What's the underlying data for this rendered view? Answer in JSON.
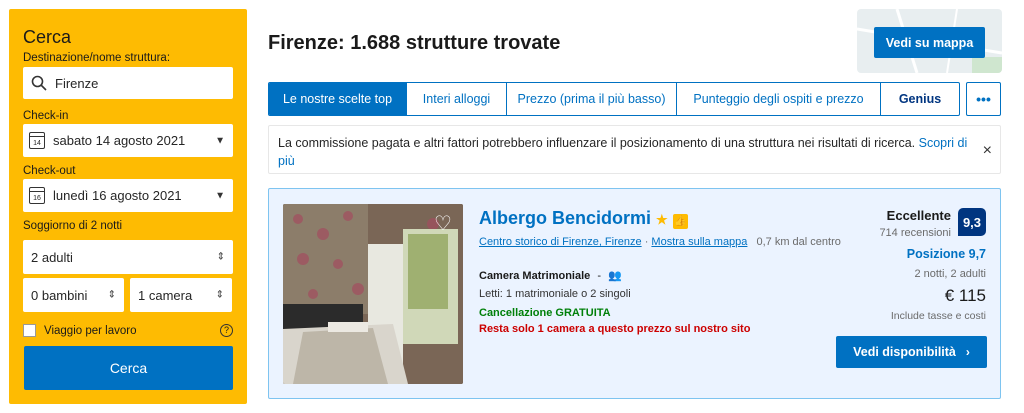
{
  "search": {
    "title": "Cerca",
    "destination_label": "Destinazione/nome struttura:",
    "destination_value": "Firenze",
    "checkin_label": "Check-in",
    "checkin_value": "sabato 14 agosto 2021",
    "checkin_day": "14",
    "checkout_label": "Check-out",
    "checkout_value": "lunedì 16 agosto 2021",
    "checkout_day": "16",
    "stay_label": "Soggiorno di 2 notti",
    "adults": "2 adulti",
    "children": "0 bambini",
    "rooms": "1 camera",
    "business_label": "Viaggio per lavoro",
    "help": "?",
    "submit": "Cerca"
  },
  "results": {
    "heading": "Firenze: 1.688 strutture trovate",
    "map_button": "Vedi su mappa"
  },
  "sort_tabs": [
    {
      "label": "Le nostre scelte top"
    },
    {
      "label": "Interi alloggi"
    },
    {
      "label": "Prezzo (prima il più basso)"
    },
    {
      "label": "Punteggio degli ospiti e prezzo"
    },
    {
      "label": "Genius"
    }
  ],
  "more_label": "•••",
  "notice": {
    "text": "La commissione pagata e altri fattori potrebbero influenzare il posizionamento di una struttura nei risultati di ricerca.",
    "link": "Scopri di più",
    "close": "×"
  },
  "property": {
    "name": "Albergo Bencidormi",
    "area": "Centro storico di Firenze, Firenze",
    "map_link": "Mostra sulla mappa",
    "distance": "0,7 km dal centro",
    "room": "Camera Matrimoniale",
    "beds": "Letti: 1 matrimoniale o 2 singoli",
    "cancellation": "Cancellazione GRATUITA",
    "scarcity": "Resta solo 1 camera a questo prezzo sul nostro sito",
    "rating_word": "Eccellente",
    "reviews": "714 recensioni",
    "score": "9,3",
    "location_score": "Posizione 9,7",
    "stay": "2 notti, 2 adulti",
    "price": "€ 115",
    "taxes": "Include tasse e costi",
    "cta": "Vedi disponibilità"
  },
  "colors": {
    "accent": "#0071c2",
    "sidebar": "#febb02",
    "score": "#003580",
    "green": "#008009",
    "red": "#cc0000"
  }
}
